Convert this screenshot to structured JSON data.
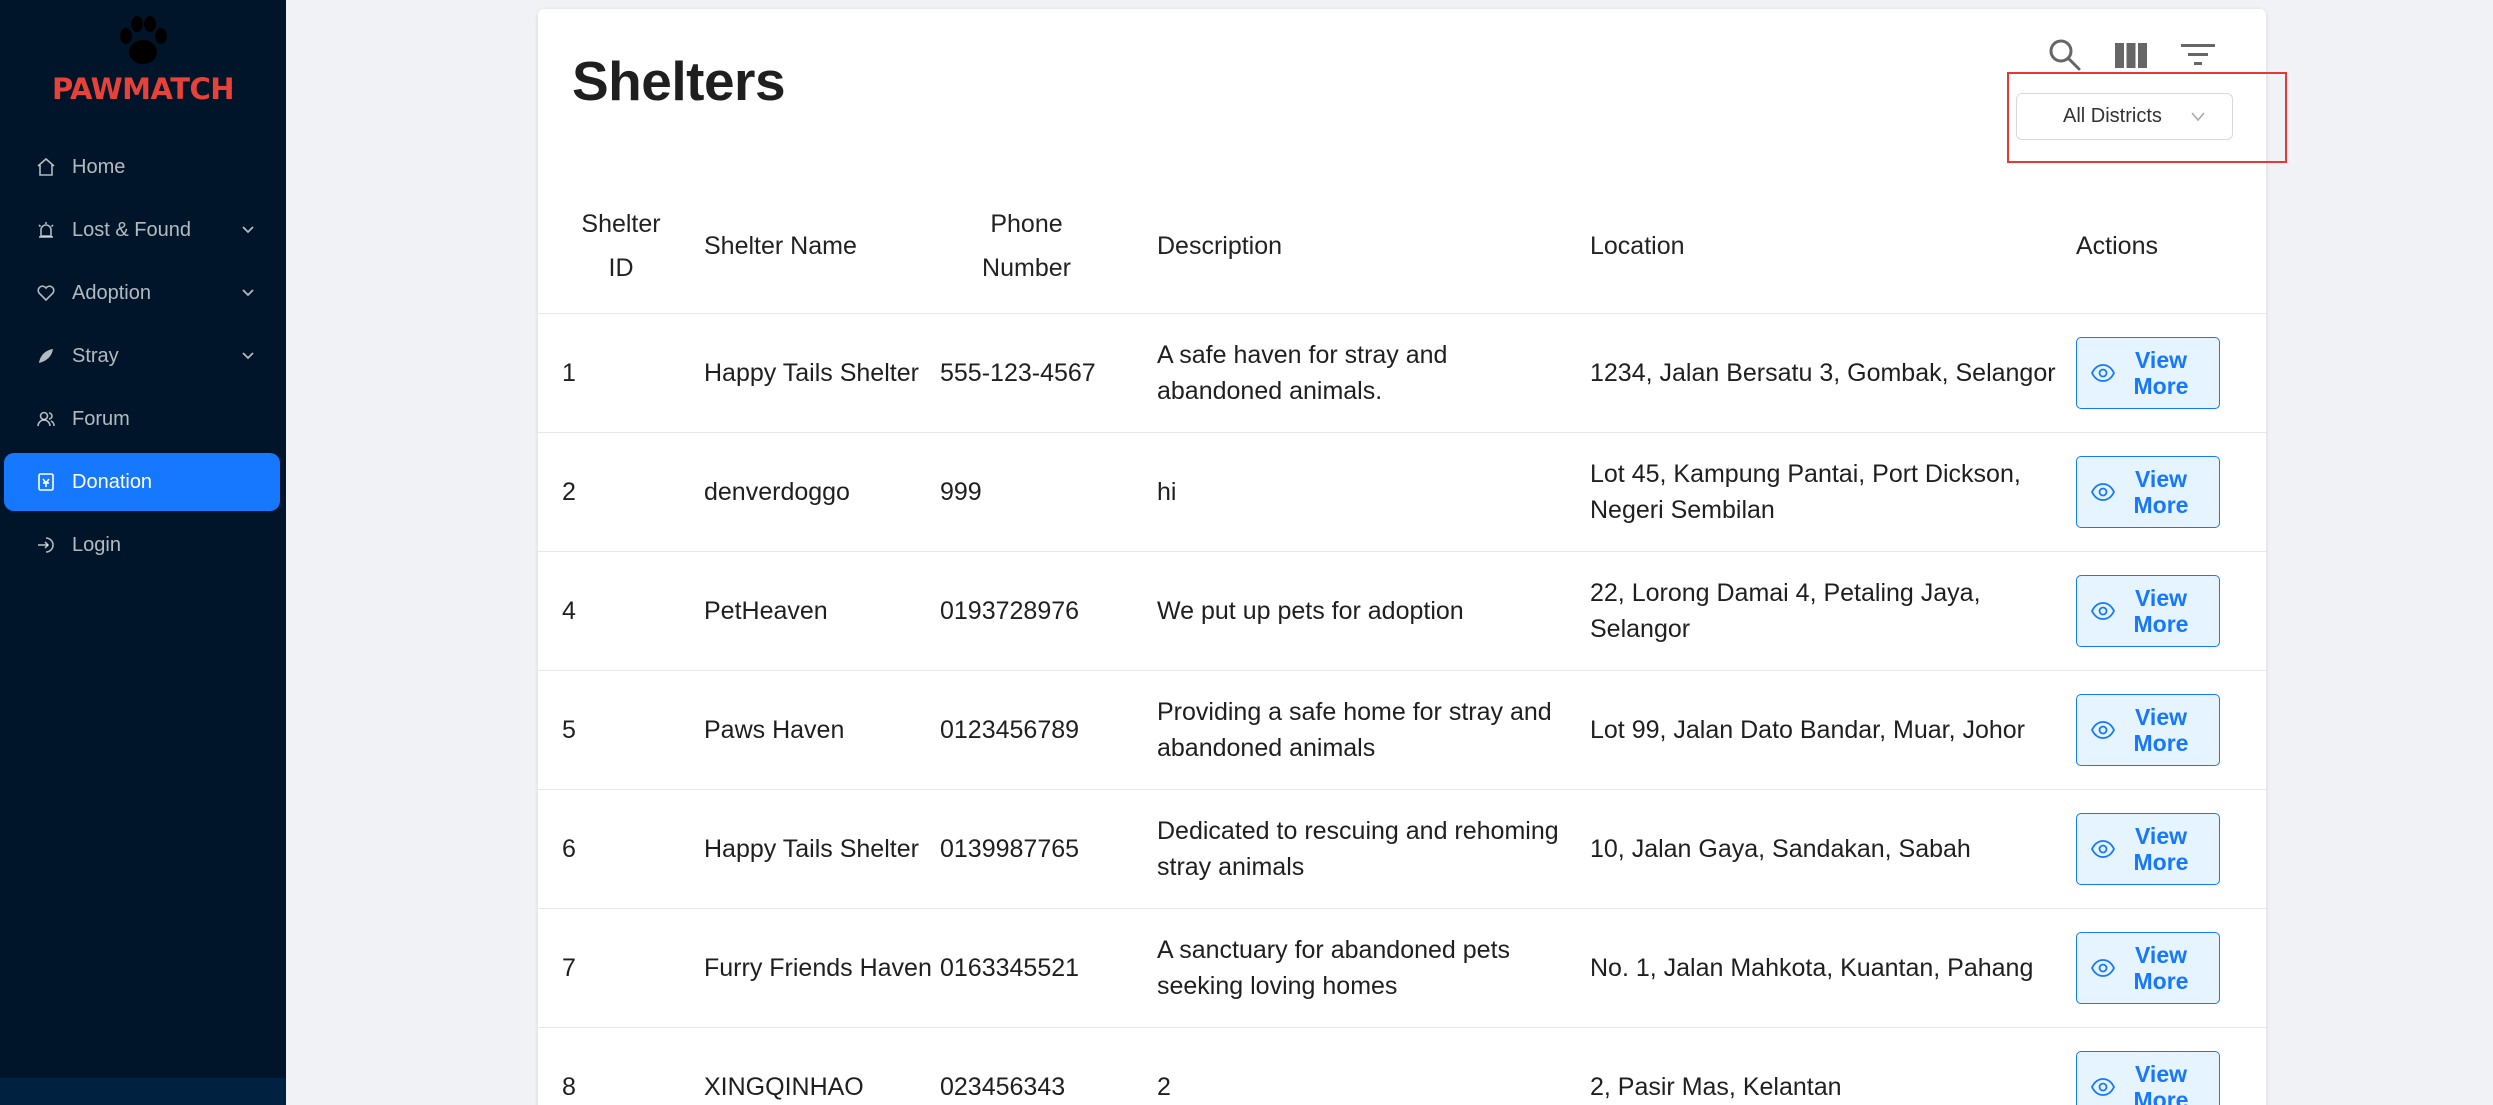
{
  "app": {
    "logo_text": "PAWMATCH"
  },
  "sidebar": {
    "items": [
      {
        "label": "Home",
        "icon": "home-icon",
        "expandable": false,
        "active": false
      },
      {
        "label": "Lost & Found",
        "icon": "alarm-icon",
        "expandable": true,
        "active": false
      },
      {
        "label": "Adoption",
        "icon": "heart-icon",
        "expandable": true,
        "active": false
      },
      {
        "label": "Stray",
        "icon": "leaf-icon",
        "expandable": true,
        "active": false
      },
      {
        "label": "Forum",
        "icon": "users-icon",
        "expandable": false,
        "active": false
      },
      {
        "label": "Donation",
        "icon": "donation-icon",
        "expandable": false,
        "active": true
      },
      {
        "label": "Login",
        "icon": "login-icon",
        "expandable": false,
        "active": false
      }
    ]
  },
  "main": {
    "title": "Shelters",
    "toolbar": {
      "search_icon": "search-icon",
      "columns_icon": "columns-icon",
      "filter_icon": "filter-icon"
    },
    "district_filter": {
      "selected": "All Districts"
    },
    "table": {
      "headers": {
        "id_line1": "Shelter",
        "id_line2": "ID",
        "name": "Shelter Name",
        "phone_line1": "Phone",
        "phone_line2": "Number",
        "description": "Description",
        "location": "Location",
        "actions": "Actions"
      },
      "action_label_line1": "View",
      "action_label_line2": "More",
      "rows": [
        {
          "id": "1",
          "name": "Happy Tails Shelter",
          "phone": "555-123-4567",
          "description": "A safe haven for stray and abandoned animals.",
          "location": "1234, Jalan Bersatu 3, Gombak, Selangor"
        },
        {
          "id": "2",
          "name": "denverdoggo",
          "phone": "999",
          "description": "hi",
          "location": "Lot 45, Kampung Pantai, Port Dickson, Negeri Sembilan"
        },
        {
          "id": "4",
          "name": "PetHeaven",
          "phone": "0193728976",
          "description": "We put up pets for adoption",
          "location": "22, Lorong Damai 4, Petaling Jaya, Selangor"
        },
        {
          "id": "5",
          "name": "Paws Haven",
          "phone": "0123456789",
          "description": "Providing a safe home for stray and abandoned animals",
          "location": "Lot 99, Jalan Dato Bandar, Muar, Johor"
        },
        {
          "id": "6",
          "name": "Happy Tails Shelter",
          "phone": "0139987765",
          "description": "Dedicated to rescuing and rehoming stray animals",
          "location": "10, Jalan Gaya, Sandakan, Sabah"
        },
        {
          "id": "7",
          "name": "Furry Friends Haven",
          "phone": "0163345521",
          "description": "A sanctuary for abandoned pets seeking loving homes",
          "location": "No. 1, Jalan Mahkota, Kuantan, Pahang"
        },
        {
          "id": "8",
          "name": "XINGQINHAO",
          "phone": "023456343",
          "description": "2",
          "location": "2, Pasir Mas, Kelantan"
        }
      ]
    }
  },
  "colors": {
    "sidebar_bg": "#001529",
    "accent": "#1677ff",
    "logo": "#e8413a",
    "highlight": "#e53935"
  }
}
